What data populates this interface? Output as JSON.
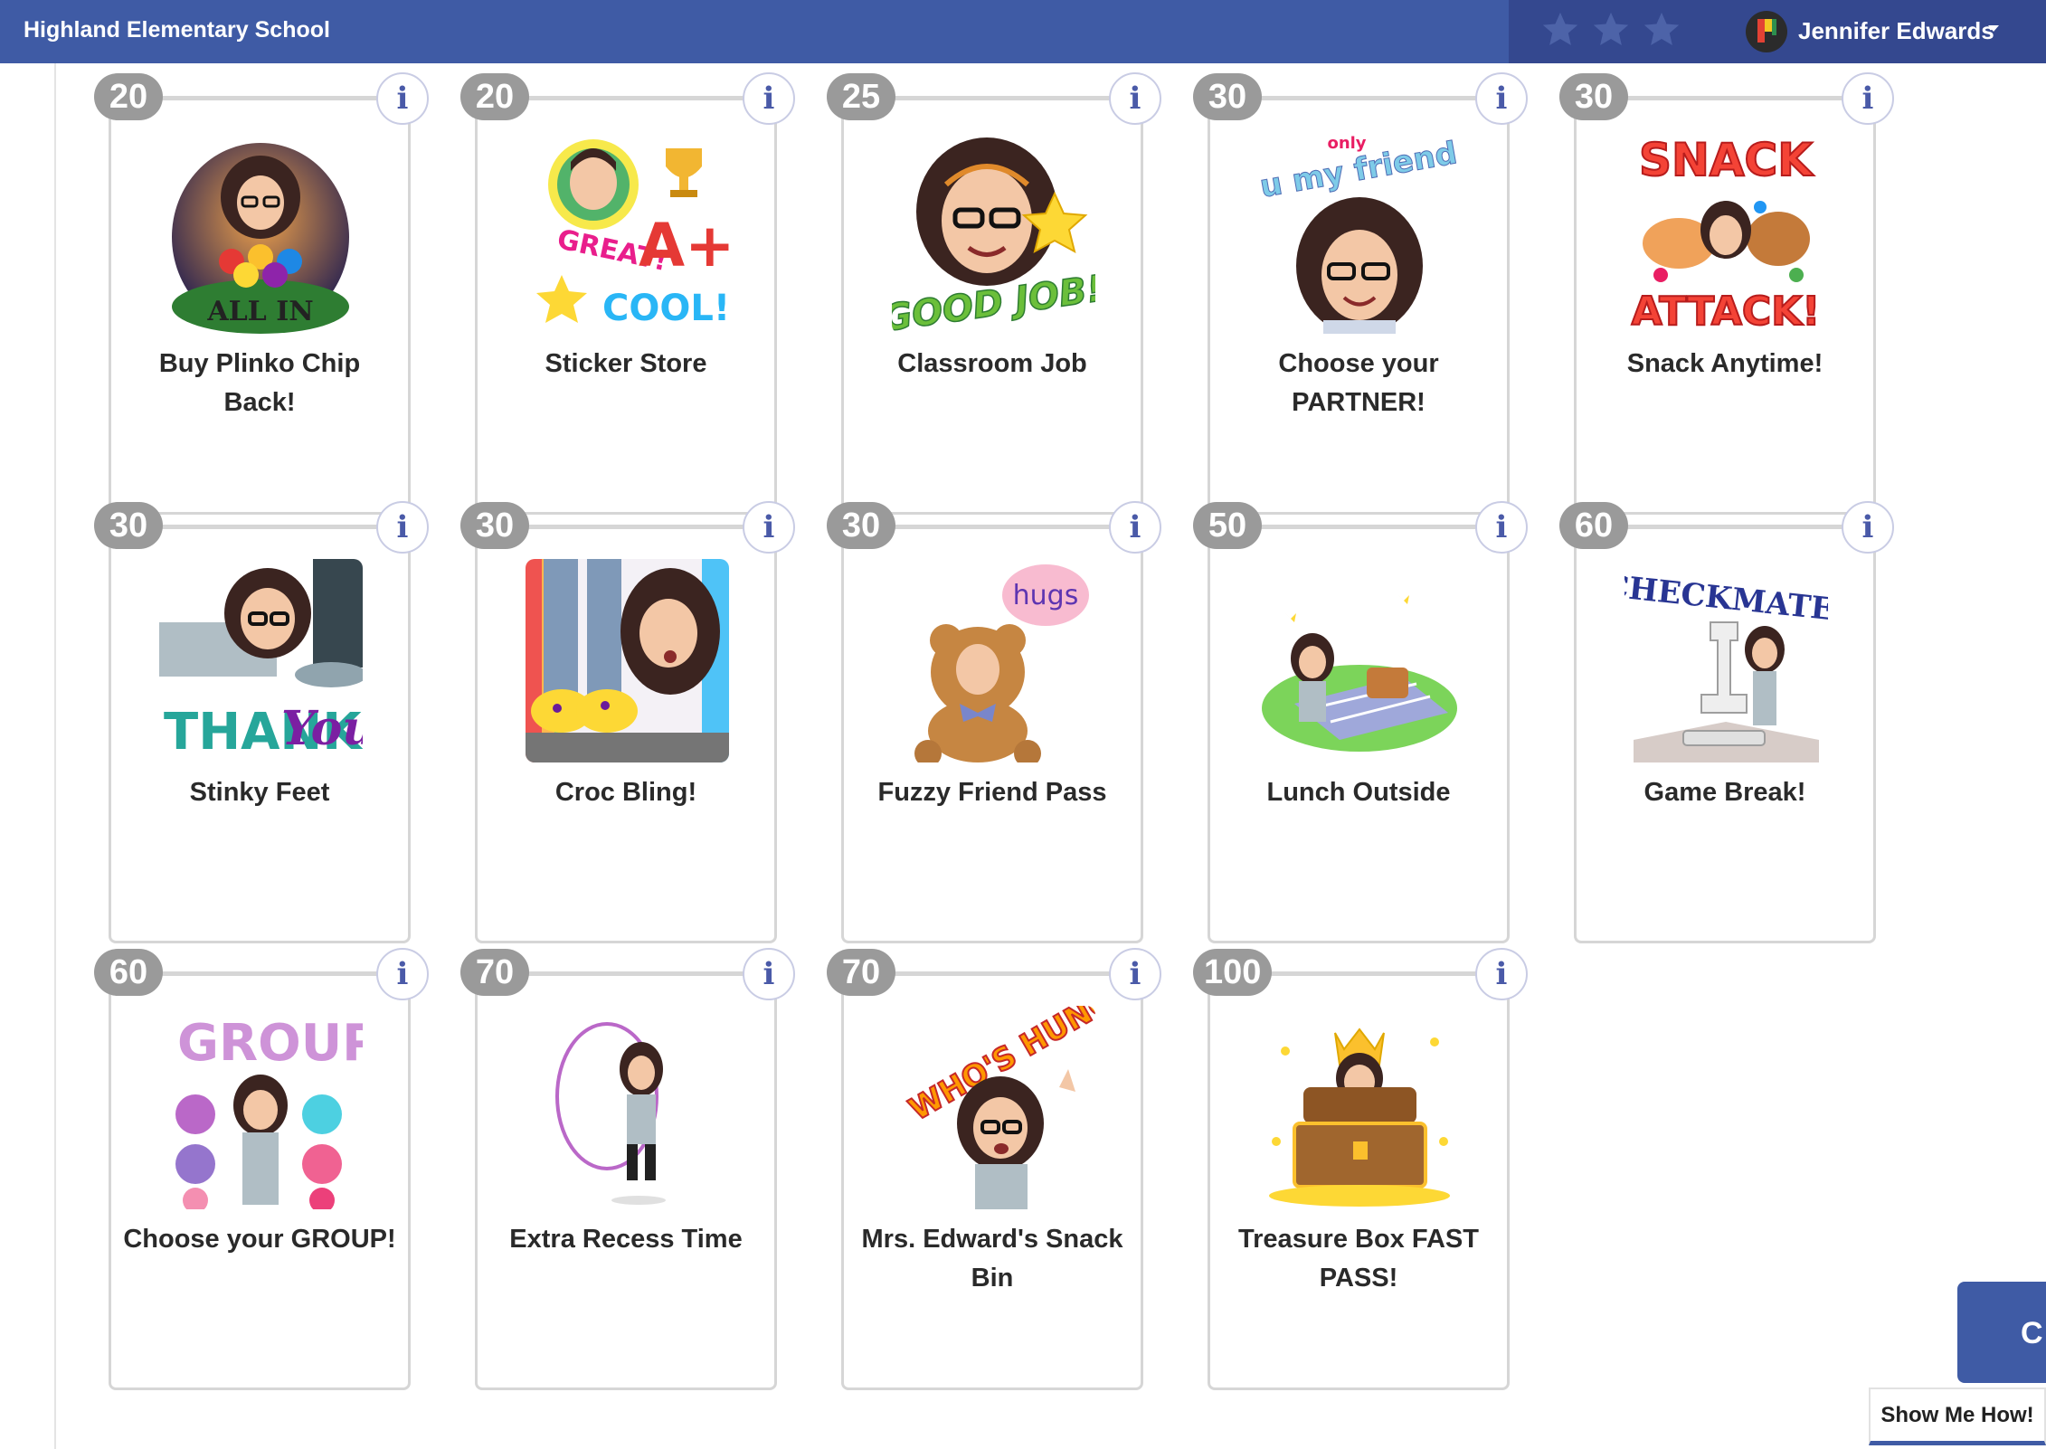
{
  "header": {
    "school_name": "Highland Elementary School",
    "user_name": "Jennifer Edwards",
    "stars": [
      "star-icon",
      "star-icon",
      "star-icon"
    ],
    "colors": {
      "bar": "#3f5ba5",
      "bar_right": "#34488f"
    }
  },
  "rewards": [
    {
      "price": "20",
      "title": "Buy Plinko Chip Back!",
      "art": "casino-chips-art"
    },
    {
      "price": "20",
      "title": "Sticker Store",
      "art": "stickers-art"
    },
    {
      "price": "25",
      "title": "Classroom Job",
      "art": "good-job-art"
    },
    {
      "price": "30",
      "title": "Choose your PARTNER!",
      "art": "friend-art"
    },
    {
      "price": "30",
      "title": "Snack Anytime!",
      "art": "snack-attack-art"
    },
    {
      "price": "30",
      "title": "Stinky Feet",
      "art": "thank-you-art"
    },
    {
      "price": "30",
      "title": "Croc Bling!",
      "art": "croc-shoes-art"
    },
    {
      "price": "30",
      "title": "Fuzzy Friend Pass",
      "art": "teddy-bear-art"
    },
    {
      "price": "50",
      "title": "Lunch Outside",
      "art": "picnic-art"
    },
    {
      "price": "60",
      "title": "Game Break!",
      "art": "checkmate-art"
    },
    {
      "price": "60",
      "title": "Choose your GROUP!",
      "art": "group-art"
    },
    {
      "price": "70",
      "title": "Extra Recess Time",
      "art": "jump-rope-art"
    },
    {
      "price": "70",
      "title": "Mrs. Edward's Snack Bin",
      "art": "hungry-art"
    },
    {
      "price": "100",
      "title": "Treasure Box FAST PASS!",
      "art": "treasure-chest-art"
    }
  ],
  "art_text": {
    "all_in": "ALL IN",
    "great": "GREAT!",
    "a_plus": "A+",
    "cool": "COOL!",
    "good_job": "GOOD JOB!",
    "u_my_friend": "u my friend",
    "only": "only",
    "snack": "SNACK",
    "attack": "ATTACK!",
    "thank": "THANK",
    "you": "You",
    "hugs": "hugs",
    "checkmate": "CHECKMATE!",
    "group": "GROUP",
    "whos_hungry": "WHO'S HUNGRY?"
  },
  "info_label": "i",
  "side_tab_label": "C",
  "show_me_label": "Show Me How!"
}
